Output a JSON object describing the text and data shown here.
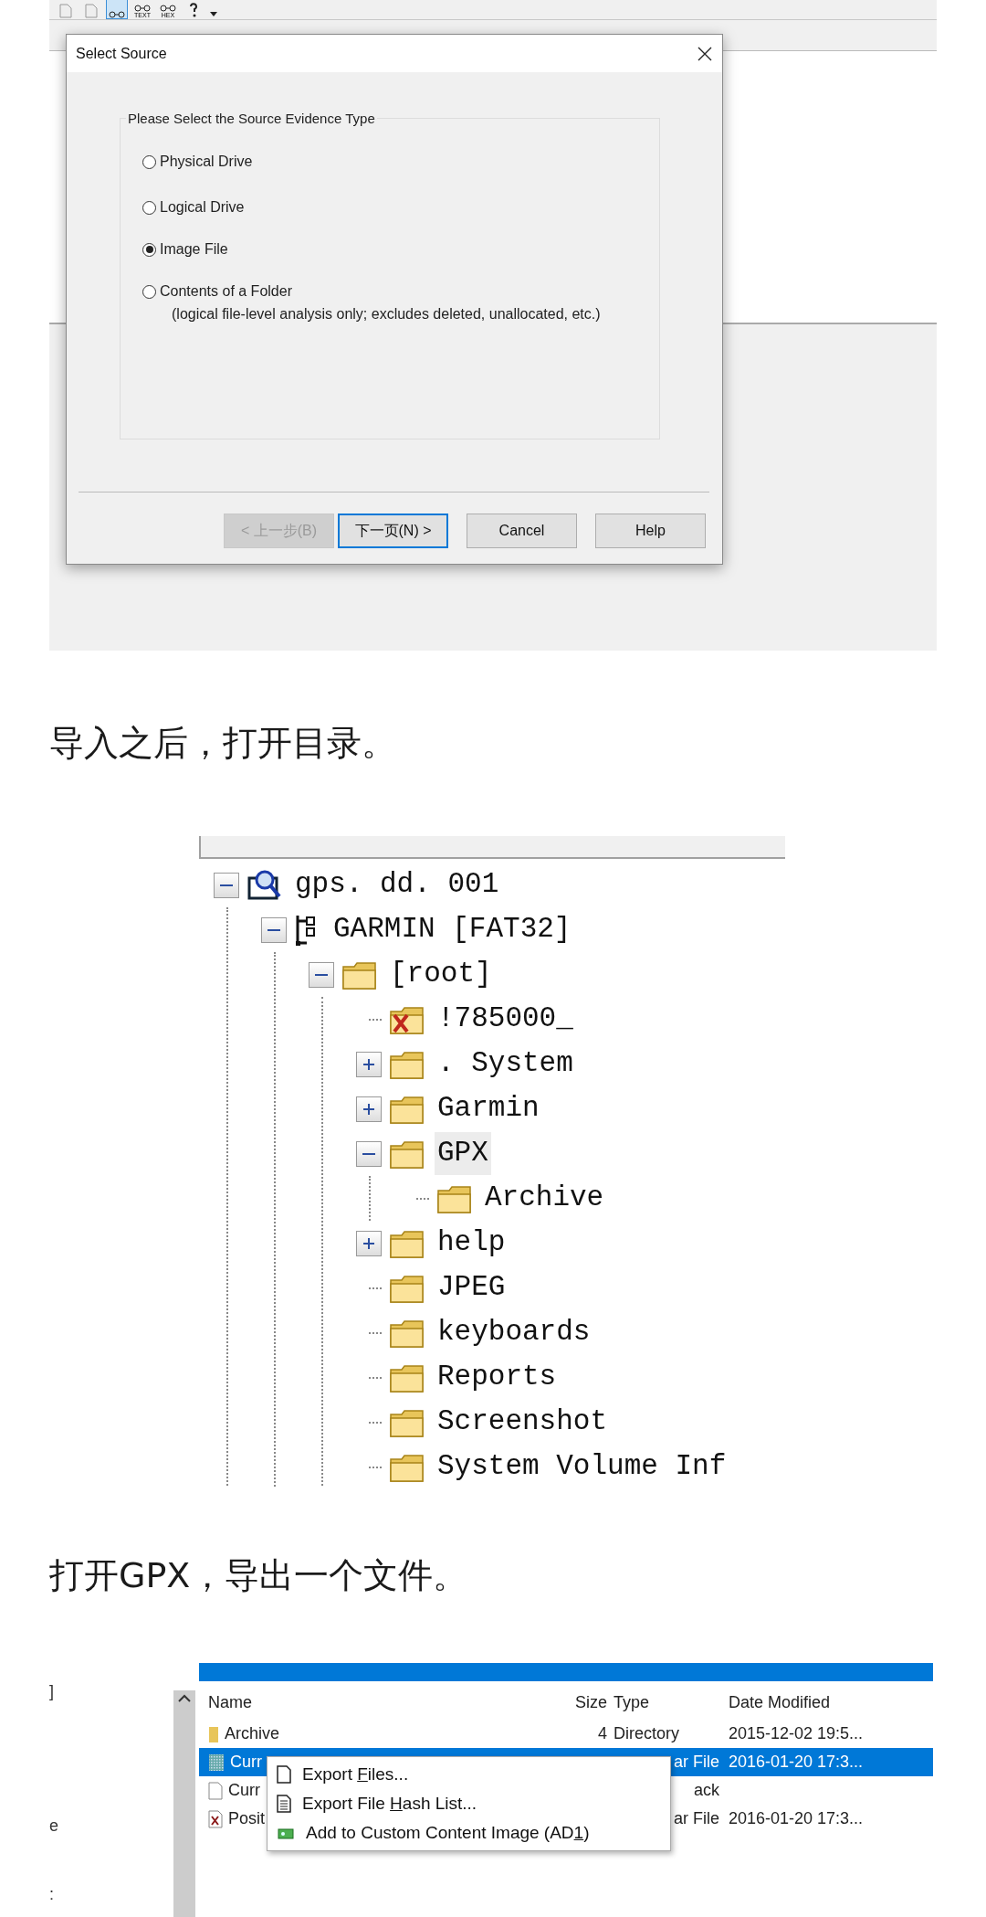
{
  "dialog_shot": {
    "toolbar": [
      {
        "kind": "doc",
        "selected": false
      },
      {
        "kind": "doc",
        "selected": false
      },
      {
        "kind": "view",
        "selected": true
      },
      {
        "kind": "view",
        "label": "TEXT",
        "selected": false
      },
      {
        "kind": "view",
        "label": "HEX",
        "selected": false
      },
      {
        "kind": "help",
        "selected": false
      },
      {
        "kind": "caret",
        "selected": false
      }
    ],
    "dialog": {
      "title": "Select Source",
      "group_label": "Please Select the Source Evidence Type",
      "options": [
        {
          "label": "Physical Drive",
          "selected": false
        },
        {
          "label": "Logical Drive",
          "selected": false
        },
        {
          "label": "Image File",
          "selected": true
        },
        {
          "label": "Contents of a Folder",
          "note": "(logical file-level analysis only; excludes deleted, unallocated, etc.)",
          "selected": false
        }
      ],
      "buttons": [
        {
          "label": "< 上一步(B)",
          "disabled": true,
          "default": false
        },
        {
          "label": "下一页(N) >",
          "disabled": false,
          "default": true
        },
        {
          "label": "Cancel",
          "disabled": false,
          "default": false
        },
        {
          "label": "Help",
          "disabled": false,
          "default": false
        }
      ]
    }
  },
  "caption_1": "导入之后，打开目录。",
  "tree": [
    {
      "label": "gps. dd. 001",
      "kind": "evidence",
      "expanded": true,
      "selected": false,
      "children": [
        {
          "label": "GARMIN [FAT32]",
          "kind": "volume",
          "expanded": true,
          "selected": false,
          "children": [
            {
              "label": "[root]",
              "kind": "folder",
              "expanded": true,
              "selected": false,
              "children": [
                {
                  "label": "!785000_",
                  "kind": "deleted",
                  "selected": false
                },
                {
                  "label": ". System",
                  "kind": "folder",
                  "expanded": false,
                  "selected": false
                },
                {
                  "label": "Garmin",
                  "kind": "folder",
                  "expanded": false,
                  "selected": false
                },
                {
                  "label": "GPX",
                  "kind": "folder",
                  "expanded": true,
                  "selected": true,
                  "children": [
                    {
                      "label": "Archive",
                      "kind": "folder",
                      "selected": false
                    }
                  ]
                },
                {
                  "label": "help",
                  "kind": "folder",
                  "expanded": false,
                  "selected": false
                },
                {
                  "label": "JPEG",
                  "kind": "folder",
                  "selected": false
                },
                {
                  "label": "keyboards",
                  "kind": "folder",
                  "selected": false
                },
                {
                  "label": "Reports",
                  "kind": "folder",
                  "selected": false
                },
                {
                  "label": "Screenshot",
                  "kind": "folder",
                  "selected": false
                },
                {
                  "label": "System Volume Inf",
                  "kind": "folder",
                  "selected": false
                }
              ]
            }
          ]
        }
      ]
    }
  ],
  "caption_2": "打开GPX，导出一个文件。",
  "file_list": {
    "left_pane": [
      "]",
      "e",
      ":"
    ],
    "columns": [
      "Name",
      "Size",
      "Type",
      "Date Modified"
    ],
    "rows": [
      {
        "kind": "folder",
        "name": "Archive",
        "size": "4",
        "type": "Directory",
        "date": "2015-12-02 19:5...",
        "selected": false,
        "covered": false
      },
      {
        "kind": "hatched",
        "name": "Curr",
        "type": "ar File",
        "date": "2016-01-20 17:3...",
        "selected": true,
        "covered": true
      },
      {
        "kind": "file",
        "name": "Curr",
        "type": "ack",
        "selected": false,
        "covered": true
      },
      {
        "kind": "deleted",
        "name": "Posit",
        "type": "ar File",
        "date": "2016-01-20 17:3...",
        "selected": false,
        "covered": true
      }
    ],
    "context_menu": [
      {
        "kind": "page",
        "before": "Export ",
        "key": "F",
        "after": "iles..."
      },
      {
        "kind": "list",
        "before": "Export File ",
        "key": "H",
        "after": "ash List..."
      },
      {
        "kind": "image",
        "before": "Add to Custom Content Image (AD",
        "key": "1",
        "after": ")"
      }
    ]
  }
}
